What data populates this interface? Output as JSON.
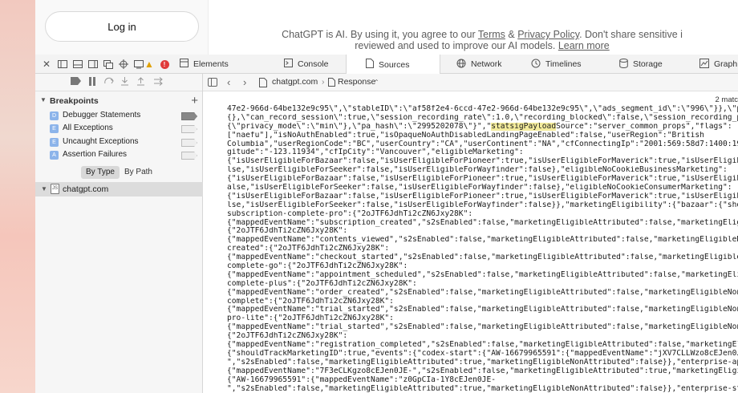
{
  "page": {
    "login_label": "Log in",
    "terms_line1_a": "ChatGPT is AI. By using it, you agree to our ",
    "terms_link": "Terms",
    "terms_line1_b": " & ",
    "privacy_link": "Privacy Policy",
    "terms_line1_c": ". Don't share sensitive i",
    "terms_line2_a": "reviewed and used to improve our AI models. ",
    "learn_more": "Learn more"
  },
  "toolbar": {
    "tabs": [
      {
        "label": "Elements",
        "icon": "elements-icon"
      },
      {
        "label": "Console",
        "icon": "console-icon"
      },
      {
        "label": "Sources",
        "icon": "sources-icon"
      },
      {
        "label": "Network",
        "icon": "network-icon"
      },
      {
        "label": "Timelines",
        "icon": "timelines-icon"
      },
      {
        "label": "Storage",
        "icon": "storage-icon"
      },
      {
        "label": "Graph",
        "icon": "graph-icon"
      }
    ],
    "error_glyph": "!"
  },
  "sidebar": {
    "breakpoints_title": "Breakpoints",
    "add_glyph": "+",
    "breakpoints": [
      {
        "label": "Debugger Statements",
        "glyph": "D",
        "enabled": true
      },
      {
        "label": "All Exceptions",
        "glyph": "E",
        "enabled": false
      },
      {
        "label": "Uncaught Exceptions",
        "glyph": "E",
        "enabled": false
      },
      {
        "label": "Assertion Failures",
        "glyph": "A",
        "enabled": false
      }
    ],
    "by_type": "By Type",
    "by_path": "By Path",
    "tree_item": "chatgpt.com",
    "tree_doc_glyph": "JS"
  },
  "content": {
    "breadcrumb_domain": "chatgpt.com",
    "breadcrumb_sep": "›",
    "breadcrumb_resource": "Response",
    "resource_chevron": "⌃",
    "match_count": "2 matc",
    "code_lines": [
      {
        "pre": "47e2-966d-64be132e9c95\\\",\\\"stableID\\\":\\\"af58f2e4-6ccd-47e2-966d-64be132e9c95\\\",\\\"ads_segment_id\\\":\\\"996\\\"}},\\\"param_",
        "hl": "",
        "post": ""
      },
      {
        "pre": "{},\\\"can_record_session\\\":true,\\\"session_recording_rate\\\":1.0,\\\"recording_blocked\\\":false,\\\"session_recording_priva",
        "hl": "",
        "post": ""
      },
      {
        "pre": "{\\\"privacy_mode\\\":\\\"min\\\"},\\\"pa_hash\\\":\\\"2995202078\\\"}\",\"",
        "hl": "statsigPayload",
        "post": "Source\":\"server_common_props\",\"flags\":"
      },
      {
        "pre": "[\"naefu\"],\"isNoAuthEnabled\":true,\"isOpaqueNoAuthDisabledLandingPageEnabled\":false,\"userRegion\":\"British",
        "hl": "",
        "post": ""
      },
      {
        "pre": "Columbia\",\"userRegionCode\":\"BC\",\"userCountry\":\"CA\",\"userContinent\":\"NA\",\"cfConnectingIp\":\"2001:569:58d7:1400:197a:15",
        "hl": "",
        "post": ""
      },
      {
        "pre": "gitude\":\"-123.11934\",\"cfIpCity\":\"Vancouver\",\"eligibleMarketing\":",
        "hl": "",
        "post": ""
      },
      {
        "pre": "{\"isUserEligibleForBazaar\":false,\"isUserEligibleForPioneer\":true,\"isUserEligibleForMaverick\":true,\"isUserEligibleFo",
        "hl": "",
        "post": ""
      },
      {
        "pre": "lse,\"isUserEligibleForSeeker\":false,\"isUserEligibleForWayfinder\":false},\"eligibleNoCookieBusinessMarketing\":",
        "hl": "",
        "post": ""
      },
      {
        "pre": "{\"isUserEligibleForBazaar\":false,\"isUserEligibleForPioneer\":true,\"isUserEligibleForMaverick\":true,\"isUserEligibleFo",
        "hl": "",
        "post": ""
      },
      {
        "pre": "alse,\"isUserEligibleForSeeker\":false,\"isUserEligibleForWayfinder\":false},\"eligibleNoCookieConsumerMarketing\":",
        "hl": "",
        "post": ""
      },
      {
        "pre": "{\"isUserEligibleForBazaar\":false,\"isUserEligibleForPioneer\":true,\"isUserEligibleForMaverick\":true,\"isUserEligibleFo",
        "hl": "",
        "post": ""
      },
      {
        "pre": "lse,\"isUserEligibleForSeeker\":false,\"isUserEligibleForWayfinder\":false}},\"marketingEligibility\":{\"bazaar\":{\"shouldTra",
        "hl": "",
        "post": ""
      },
      {
        "pre": "subscription-complete-pro\":{\"2oJTF6JdhTi2cZN6Jxy28K\":",
        "hl": "",
        "post": ""
      },
      {
        "pre": "{\"mappedEventName\":\"subscription_created\",\"s2sEnabled\":false,\"marketingEligibleAttributed\":false,\"marketingEligibleN",
        "hl": "",
        "post": ""
      },
      {
        "pre": "{\"2oJTF6JdhTi2cZN6Jxy28K\":",
        "hl": "",
        "post": ""
      },
      {
        "pre": "{\"mappedEventName\":\"contents_viewed\",\"s2sEnabled\":false,\"marketingEligibleAttributed\":false,\"marketingEligibleNonAtt",
        "hl": "",
        "post": ""
      },
      {
        "pre": "created\":{\"2oJTF6JdhTi2cZN6Jxy28K\":",
        "hl": "",
        "post": ""
      },
      {
        "pre": "{\"mappedEventName\":\"checkout_started\",\"s2sEnabled\":false,\"marketingEligibleAttributed\":false,\"marketingEligibleNonAtt",
        "hl": "",
        "post": ""
      },
      {
        "pre": "complete-go\":{\"2oJTF6JdhTi2cZN6Jxy28K\":",
        "hl": "",
        "post": ""
      },
      {
        "pre": "{\"mappedEventName\":\"appointment_scheduled\",\"s2sEnabled\":false,\"marketingEligibleAttributed\":false,\"marketingEligibleNonAttr",
        "hl": "",
        "post": ""
      },
      {
        "pre": "complete-plus\":{\"2oJTF6JdhTi2cZN6Jxy28K\":",
        "hl": "",
        "post": ""
      },
      {
        "pre": "{\"mappedEventName\":\"order_created\",\"s2sEnabled\":false,\"marketingEligibleAttributed\":false,\"marketingEligibleNonAttri",
        "hl": "",
        "post": ""
      },
      {
        "pre": "complete\":{\"2oJTF6JdhTi2cZN6Jxy28K\":",
        "hl": "",
        "post": ""
      },
      {
        "pre": "{\"mappedEventName\":\"trial_started\",\"s2sEnabled\":false,\"marketingEligibleAttributed\":false,\"marketingEligibleNonAttri",
        "hl": "",
        "post": ""
      },
      {
        "pre": "pro-lite\":{\"2oJTF6JdhTi2cZN6Jxy28K\":",
        "hl": "",
        "post": ""
      },
      {
        "pre": "{\"mappedEventName\":\"trial_started\",\"s2sEnabled\":false,\"marketingEligibleAttributed\":false,\"marketingEligibleNonAttri",
        "hl": "",
        "post": ""
      },
      {
        "pre": "{\"2oJTF6JdhTi2cZN6Jxy28K\":",
        "hl": "",
        "post": ""
      },
      {
        "pre": "{\"mappedEventName\":\"registration_completed\",\"s2sEnabled\":false,\"marketingEligibleAttributed\":false,\"marketingEligibl",
        "hl": "",
        "post": ""
      },
      {
        "pre": "{\"shouldTrackMarketingID\":true,\"events\":{\"codex-start\":{\"AW-16679965591\":{\"mappedEventName\":\"jXV7CLLWzo8cEJen0JE-",
        "hl": "",
        "post": ""
      },
      {
        "pre": "\",\"s2sEnabled\":false,\"marketingEligibleAttributed\":true,\"marketingEligibleNonAttributed\":false}},\"enterprise-api-fo",
        "hl": "",
        "post": ""
      },
      {
        "pre": "{\"mappedEventName\":\"7F3eCLKgzo8cEJen0JE-\",\"s2sEnabled\":false,\"marketingEligibleAttributed\":true,\"marketingEligibleN",
        "hl": "",
        "post": ""
      },
      {
        "pre": "{\"AW-16679965591\":{\"mappedEventName\":\"z0GpCIa-1Y8cEJen0JE-",
        "hl": "",
        "post": ""
      },
      {
        "pre": "\",\"s2sEnabled\":false,\"marketingEligibleAttributed\":true,\"marketingEligibleNonAttributed\":false}},\"enterprise-start\"",
        "hl": "",
        "post": ""
      }
    ]
  }
}
